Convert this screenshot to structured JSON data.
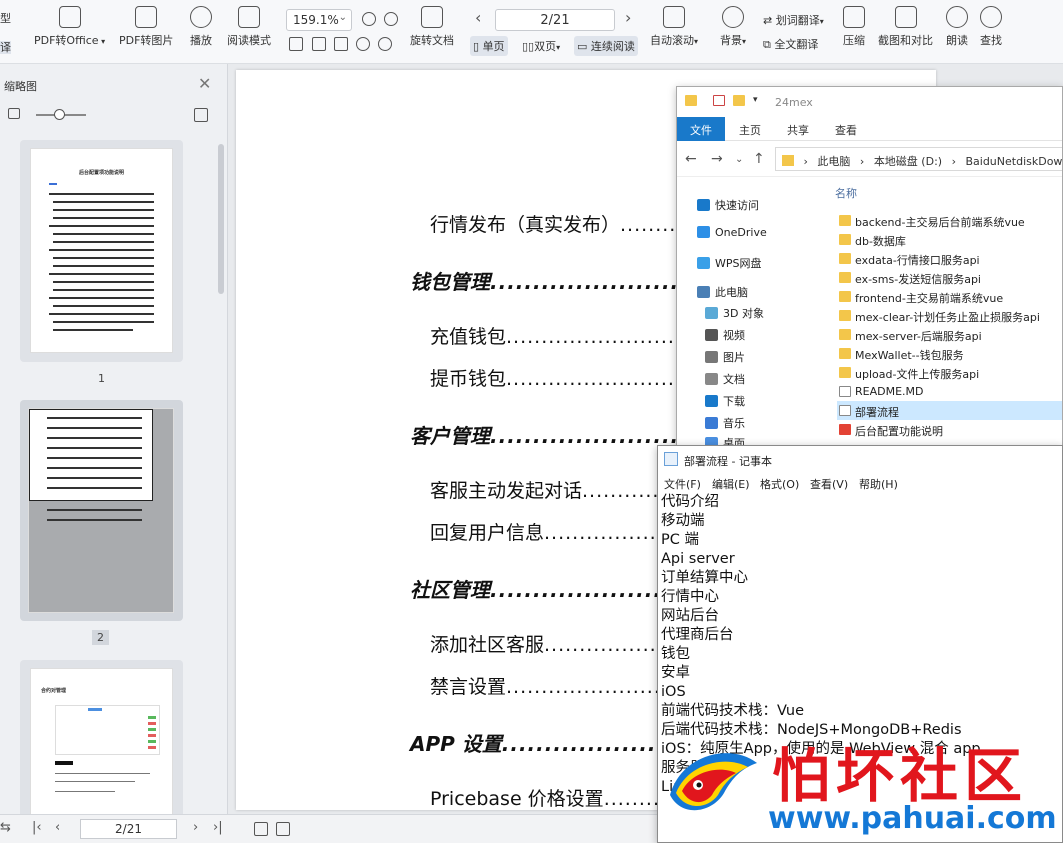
{
  "toolbar": {
    "left_top": "型",
    "left_bottom": "译",
    "pdf_to_office": "PDF转Office",
    "pdf_to_image": "PDF转图片",
    "play": "播放",
    "read_mode": "阅读模式",
    "zoom": "159.1%",
    "rotate_doc": "旋转文档",
    "page_indicator": "2/21",
    "single_page": "单页",
    "double_page": "双页",
    "continuous": "连续阅读",
    "auto_scroll": "自动滚动",
    "background": "背景",
    "word_translate": "划词翻译",
    "full_translate": "全文翻译",
    "compress": "压缩",
    "screenshot_compare": "截图和对比",
    "read_aloud": "朗读",
    "find": "查找"
  },
  "sidebar": {
    "title": "缩略图",
    "page1_label": "1",
    "page2_label": "2",
    "page1_heading": "后台配置项功能说明",
    "page3_heading": "合约对管理"
  },
  "document": {
    "entries": [
      {
        "text": "行情发布（真实发布）",
        "level": 2
      },
      {
        "text": "钱包管理",
        "level": 1
      },
      {
        "text": "充值钱包",
        "level": 2
      },
      {
        "text": "提币钱包",
        "level": 2
      },
      {
        "text": "客户管理",
        "level": 1
      },
      {
        "text": "客服主动发起对话",
        "level": 2
      },
      {
        "text": "回复用户信息",
        "level": 2
      },
      {
        "text": "社区管理",
        "level": 1
      },
      {
        "text": "添加社区客服",
        "level": 2
      },
      {
        "text": "禁言设置",
        "level": 2
      },
      {
        "text": "APP 设置",
        "level": 1
      },
      {
        "text": "Pricebase 价格设置",
        "level": 2
      }
    ]
  },
  "statusbar": {
    "page": "2/21"
  },
  "explorer": {
    "title": "24mex",
    "ribbon": [
      "文件",
      "主页",
      "共享",
      "查看"
    ],
    "address": [
      "此电脑",
      "本地磁盘 (D:)",
      "BaiduNetdiskDownlo"
    ],
    "nav": [
      "快速访问",
      "OneDrive",
      "WPS网盘",
      "此电脑",
      "3D 对象",
      "视频",
      "图片",
      "文档",
      "下载",
      "音乐",
      "桌面"
    ],
    "column_name": "名称",
    "files": [
      {
        "name": "backend-主交易后台前端系统vue",
        "type": "folder"
      },
      {
        "name": "db-数据库",
        "type": "folder"
      },
      {
        "name": "exdata-行情接口服务api",
        "type": "folder"
      },
      {
        "name": "ex-sms-发送短信服务api",
        "type": "folder"
      },
      {
        "name": "frontend-主交易前端系统vue",
        "type": "folder"
      },
      {
        "name": "mex-clear-计划任务止盈止损服务api",
        "type": "folder"
      },
      {
        "name": "mex-server-后端服务api",
        "type": "folder"
      },
      {
        "name": "MexWallet--钱包服务",
        "type": "folder"
      },
      {
        "name": "upload-文件上传服务api",
        "type": "folder"
      },
      {
        "name": "README.MD",
        "type": "doc"
      },
      {
        "name": "部署流程",
        "type": "doc"
      },
      {
        "name": "后台配置功能说明",
        "type": "pdf"
      }
    ]
  },
  "notepad": {
    "title": "部署流程 - 记事本",
    "menu": [
      "文件(F)",
      "编辑(E)",
      "格式(O)",
      "查看(V)",
      "帮助(H)"
    ],
    "lines": [
      "代码介绍",
      "移动端",
      "PC 端",
      "Api server",
      "订单结算中心",
      "行情中心",
      "网站后台",
      "代理商后台",
      "钱包",
      "安卓",
      "iOS",
      "前端代码技术栈：Vue",
      "后端代码技术栈：NodeJS+MongoDB+Redis",
      "iOS：纯原生App，使用的是 WebView 混合 app",
      "服务器",
      "Linux"
    ]
  },
  "watermark": {
    "title": "怕坏社区",
    "url": "www.pahuai.com"
  },
  "colors": {
    "accent": "#1979ca",
    "watermark_red": "#e1161d",
    "watermark_blue": "#1478d6"
  }
}
